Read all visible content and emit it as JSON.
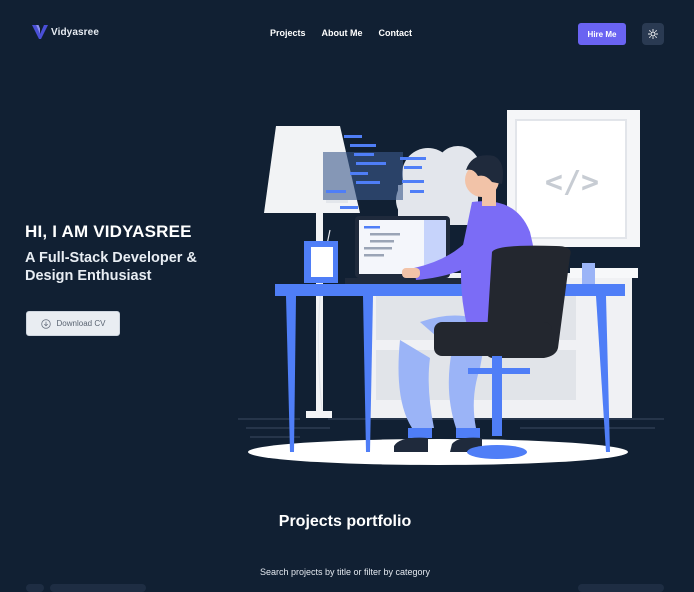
{
  "brand": {
    "name": "Vidyasree"
  },
  "nav": {
    "links": [
      "Projects",
      "About Me",
      "Contact"
    ],
    "hire_label": "Hire Me",
    "theme_icon": "sun-icon"
  },
  "hero": {
    "greeting": "HI, I AM VIDYASREE",
    "role": "A Full-Stack Developer & Design Enthusiast",
    "cv_label": "Download CV",
    "cv_icon": "download-icon",
    "illustration_code": "</>"
  },
  "portfolio": {
    "title": "Projects portfolio",
    "subtitle": "Search projects by title or filter by category"
  },
  "colors": {
    "background": "#112033",
    "accent": "#6a63f2",
    "illustration_blue": "#4f7ef7",
    "illustration_purple": "#7b6cf6"
  }
}
